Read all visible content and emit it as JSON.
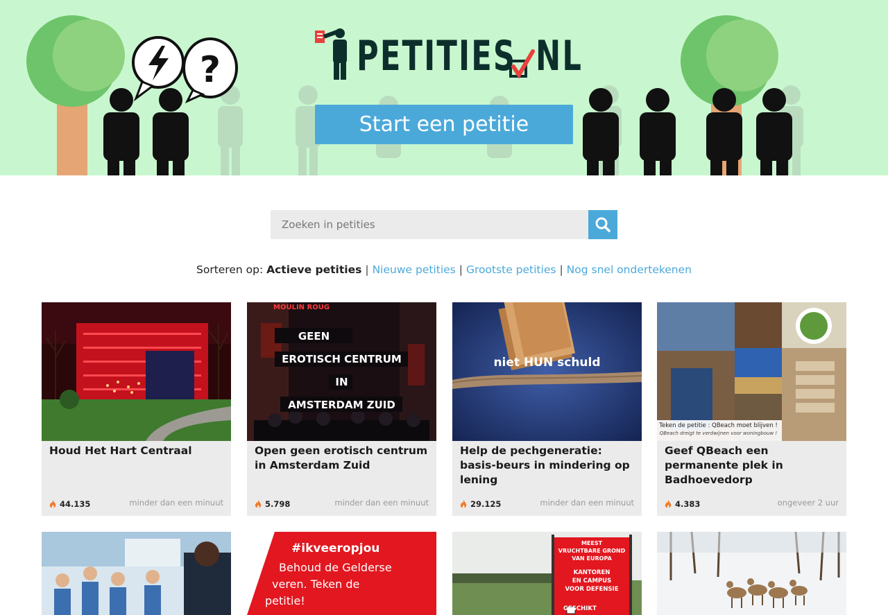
{
  "header": {
    "logo_text": "PETITIES",
    "logo_suffix": "NL",
    "start_button": "Start een petitie"
  },
  "search": {
    "placeholder": "Zoeken in petities"
  },
  "sort": {
    "label": "Sorteren op:",
    "active": "Actieve petities",
    "options": [
      "Nieuwe petities",
      "Grootste petities",
      "Nog snel ondertekenen"
    ]
  },
  "cards": [
    {
      "title": "Houd Het Hart Centraal",
      "count": "44.135",
      "time": "minder dan een minuut"
    },
    {
      "title": "Open geen erotisch centrum in Amsterdam Zuid",
      "count": "5.798",
      "time": "minder dan een minuut",
      "image_text": [
        "GEEN",
        "EROTISCH CENTRUM",
        "IN",
        "AMSTERDAM ZUID"
      ],
      "sign_text": "MOULIN ROUG"
    },
    {
      "title": "Help de pechgeneratie: basis-beurs in mindering op lening",
      "count": "29.125",
      "time": "minder dan een minuut",
      "image_text": "niet HUN schuld"
    },
    {
      "title": "Geef QBeach een permanente plek in Badhoevedorp",
      "count": "4.383",
      "time": "ongeveer 2 uur",
      "image_text": [
        "Teken de petitie : QBeach moet blijven !",
        "QBeach dreigt te verdwijnen voor woningbouw !"
      ]
    },
    {
      "title": "",
      "count": "",
      "time": ""
    },
    {
      "title": "",
      "count": "",
      "time": "",
      "image_text": [
        "#ikveeropjou",
        "Behoud de Gelderse",
        "veren. Teken de",
        "petitie!"
      ]
    },
    {
      "title": "",
      "count": "",
      "time": "",
      "image_text": [
        "MEEST",
        "VRUCHTBARE GROND",
        "VAN EUROPA",
        "KANTOREN",
        "EN CAMPUS",
        "VOOR DEFENSIE",
        "GESCHIKT"
      ]
    },
    {
      "title": "",
      "count": "",
      "time": ""
    }
  ],
  "colors": {
    "header_bg": "#c8f7cf",
    "accent": "#4ba9da",
    "card_bg": "#ebebeb",
    "flame": "#f07a2b"
  }
}
